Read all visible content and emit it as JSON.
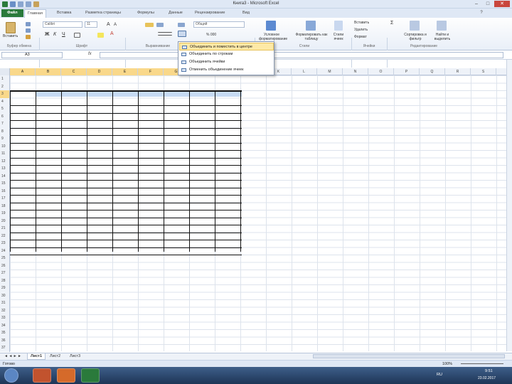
{
  "window": {
    "title": "Книга3 - Microsoft Excel"
  },
  "tabs": [
    "Файл",
    "Главная",
    "Вставка",
    "Разметка страницы",
    "Формулы",
    "Данные",
    "Рецензирование",
    "Вид"
  ],
  "ribbon": {
    "clipboard": {
      "paste_label": "Вставить",
      "group_label": "Буфер обмена"
    },
    "font": {
      "font_name": "Calibri",
      "font_size": "11",
      "group_label": "Шрифт"
    },
    "alignment": {
      "group_label": "Выравнивание"
    },
    "number": {
      "format": "Общий"
    },
    "styles": {
      "conditional": "Условное форматирование",
      "as_table": "Форматировать как таблицу",
      "cell_styles": "Стили ячеек",
      "group_label": "Стили"
    },
    "cells": {
      "insert": "Вставить",
      "delete": "Удалить",
      "format": "Формат",
      "group_label": "Ячейки"
    },
    "editing": {
      "sort": "Сортировка и фильтр",
      "find": "Найти и выделить",
      "group_label": "Редактирование"
    }
  },
  "formula_bar": {
    "name_box": "A3",
    "fx": "fx",
    "formula": ""
  },
  "merge_menu": {
    "items": [
      "Объединить и поместить в центре",
      "Объединить по строкам",
      "Объединить ячейки",
      "Отменить объединение ячеек"
    ]
  },
  "grid": {
    "columns": [
      "A",
      "B",
      "C",
      "D",
      "E",
      "F",
      "G",
      "H",
      "I",
      "J",
      "K",
      "L",
      "M",
      "N",
      "O",
      "P",
      "Q",
      "R",
      "S"
    ],
    "rows": [
      "1",
      "2",
      "3",
      "4",
      "5",
      "6",
      "7",
      "8",
      "9",
      "10",
      "11",
      "12",
      "13",
      "14",
      "15",
      "16",
      "17",
      "18",
      "19",
      "20",
      "21",
      "22",
      "23",
      "24",
      "25",
      "26",
      "27",
      "28",
      "29",
      "30",
      "31",
      "32",
      "33",
      "34",
      "35",
      "36",
      "37"
    ],
    "selected_row": "3"
  },
  "sheets": [
    "Лист1",
    "Лист2",
    "Лист3"
  ],
  "status": {
    "mode": "Готово",
    "zoom": "100%"
  },
  "clock": {
    "time": "9:51",
    "date": "23.02.2017",
    "lang": "RU"
  }
}
